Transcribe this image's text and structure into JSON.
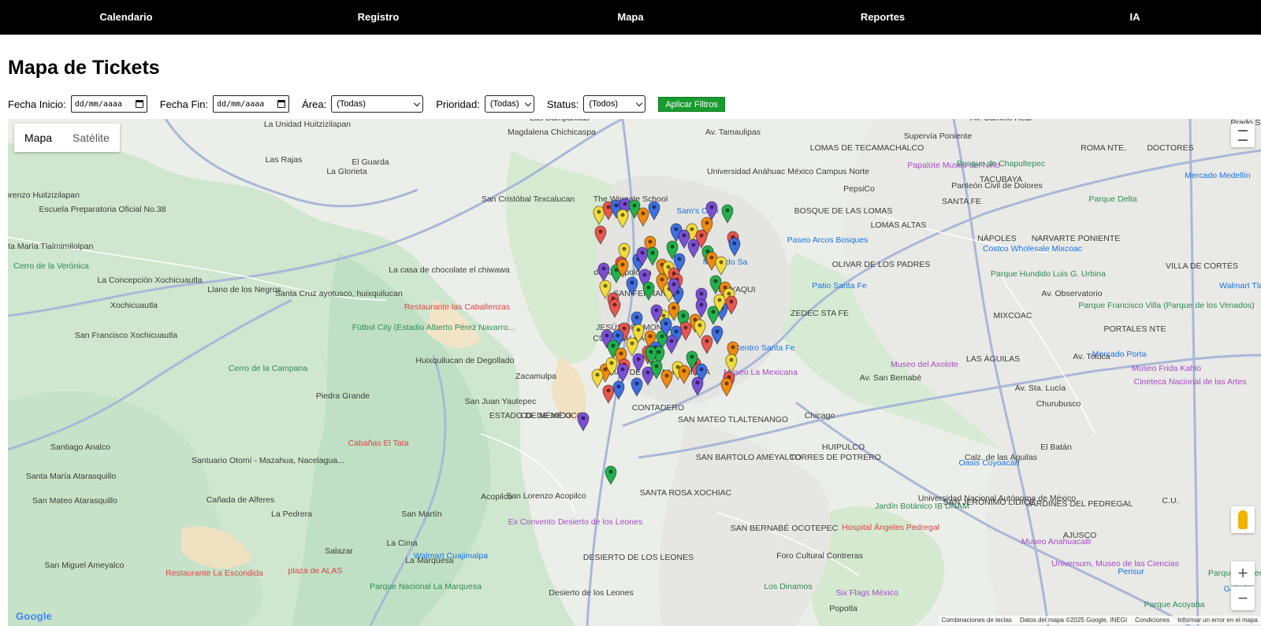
{
  "nav": {
    "items": [
      "Calendario",
      "Registro",
      "Mapa",
      "Reportes",
      "IA"
    ]
  },
  "page": {
    "title": "Mapa de Tickets"
  },
  "filters": {
    "start_label": "Fecha Inicio:",
    "start_value": "dd/mm/aaaa",
    "end_label": "Fecha Fin:",
    "end_value": "dd/mm/aaaa",
    "area_label": "Área:",
    "area_value": "(Todas)",
    "priority_label": "Prioridad:",
    "priority_value": "(Todas)",
    "status_label": "Status:",
    "status_value": "(Todos)",
    "apply_label": "Aplicar Filtros"
  },
  "map": {
    "type_map": "Mapa",
    "type_satellite": "Satélite",
    "logo": "Google",
    "attribution": {
      "shortcuts": "Combinaciones de teclas",
      "data": "Datos del mapa ©2025 Google, INEGI",
      "terms": "Condiciones",
      "report": "Informar un error en el mapa"
    },
    "labels": [
      "La Unidad Huitzizilapan",
      "Las Rajas",
      "La Glorieta",
      "El Guarda",
      "Magdalena Chichicaspa",
      "Las Campanitas",
      "San Cristóbal Texcalucan",
      "The Wingate School",
      "Escuela Preparatoria Oficial No.38",
      "San Lorenzo Huitzizilapan",
      "Santa María Tlalmimilolpan",
      "Cerro de la Verónica",
      "La Concepción Xochicuautla",
      "Llano de los Negros",
      "Xochicuautla",
      "San Francisco Xochicuautla",
      "La casa de chocolate el chiwawa",
      "Santa Cruz ayotusco, huixquilucan",
      "Restaurante las Caballerizas",
      "Fútbol City (Estadio Alberto Pérez Navarro...",
      "Huixquilucan de Degollado",
      "Cerro de la Campana",
      "Piedra Grande",
      "Zacamulpa",
      "San Juan Yautepec",
      "ESTADO DE MÉXICO",
      "CD. DE MÉXICO",
      "Cabañas El Tata",
      "Santiago Analco",
      "Santuario Otomí - Mazahua, Nacelagua...",
      "Santa María Atarasquillo",
      "San Mateo Atarasquillo",
      "Cañada de Alferes",
      "La Pedrera",
      "Acopilco",
      "San Lorenzo Acopilco",
      "Ex Convento Desierto de los Leones",
      "Salazar",
      "La Cima",
      "La Marquesa",
      "Parque Nacional La Marquesa",
      "San Miguel Ameyalco",
      "Restaurante La Escondida",
      "plaza de ALAS",
      "Desierto de los Leones",
      "DESIERTO DE LOS LEONES",
      "Universidad Anáhuac México Campus Norte",
      "PepsiCo",
      "Sam's Club",
      "Paseo Arcos Bosques",
      "Patio Santa Fe",
      "Centro Santa Fe",
      "Museo del Axolote",
      "Museo La Mexicana",
      "CONTADERO",
      "SAN MATEO TLALTENANGO",
      "SAN BARTOLO AMEYALCO",
      "TORRES DE POTRERO",
      "SANTA ROSA XOCHIAC",
      "SAN BERNABÉ OCOTEPEC",
      "Hospital Ángeles Pedregal",
      "Foro Cultural Contreras",
      "Los Dinamos",
      "Six Flags México",
      "Popotla",
      "LOMAS DE TECAMACHALCO",
      "BOSQUE DE LAS LOMAS",
      "LOMAS ALTAS",
      "ZEDEC STA FE",
      "TACUBAYA",
      "NÁPOLES",
      "NARVARTE PONIENTE",
      "MIXCOAC",
      "LAS ÁGUILAS",
      "PORTALES NTE",
      "VILLA DE CORTÉS",
      "ROMA NTE.",
      "DOCTORES",
      "Parque Delta",
      "Mercado Medellín",
      "Panteón Civil de Dolores",
      "Papalote Museo del Niño",
      "Bosque de Chapultepec",
      "Costco Wholesale Mixcoac",
      "Parque Hundido Luis G. Urbina",
      "Parque Francisco Villa (Parque de los Venados)",
      "Walmart Tla",
      "Mercado Porta",
      "Museo Frida Kahlo",
      "Cineteca Nacional de las Artes",
      "Churubusco",
      "Oasis Coyoacán",
      "El Batán",
      "Universidad Nacional Autónoma de México",
      "Jardín Botánico IB UNAM",
      "SAN JERÓNIMO LÍDICE",
      "JARDINES DEL PEDREGAL",
      "C.U.",
      "AJUSCO",
      "Museo Anahuacalli",
      "Universum, Museo de las Ciencias",
      "Perisur",
      "Parque Cantera",
      "Galería",
      "Parque Acoyaba",
      "HUIPULCO",
      "OLIVAR DE LOS PADRES",
      "SANTA FE",
      "Av. Observatorio",
      "Av. Toluca",
      "Av. Sta. Lucía",
      "Calz. de las Águilas",
      "Av. San Bernabé",
      "Chicago",
      "Av. Tamaulipas",
      "Supervía Poniente",
      "Av. Camino Real",
      "Prado Sur",
      "de Antropología",
      "Mercado Sa",
      "EL YAQUI",
      "SAN FERNANDO",
      "LOMAS DE VISTA HERMOSA",
      "JESÚS DEL MONTE",
      "CUAJIMALPA",
      "San Martín",
      "Walmart Cuajimalpa"
    ],
    "markers": {
      "colors": {
        "purple": "#7b4fd6",
        "green": "#22b14c",
        "orange": "#ef8a12",
        "yellow": "#f2dc3c",
        "red": "#e8574f",
        "blue": "#3d6fe0"
      },
      "count": 104
    }
  }
}
